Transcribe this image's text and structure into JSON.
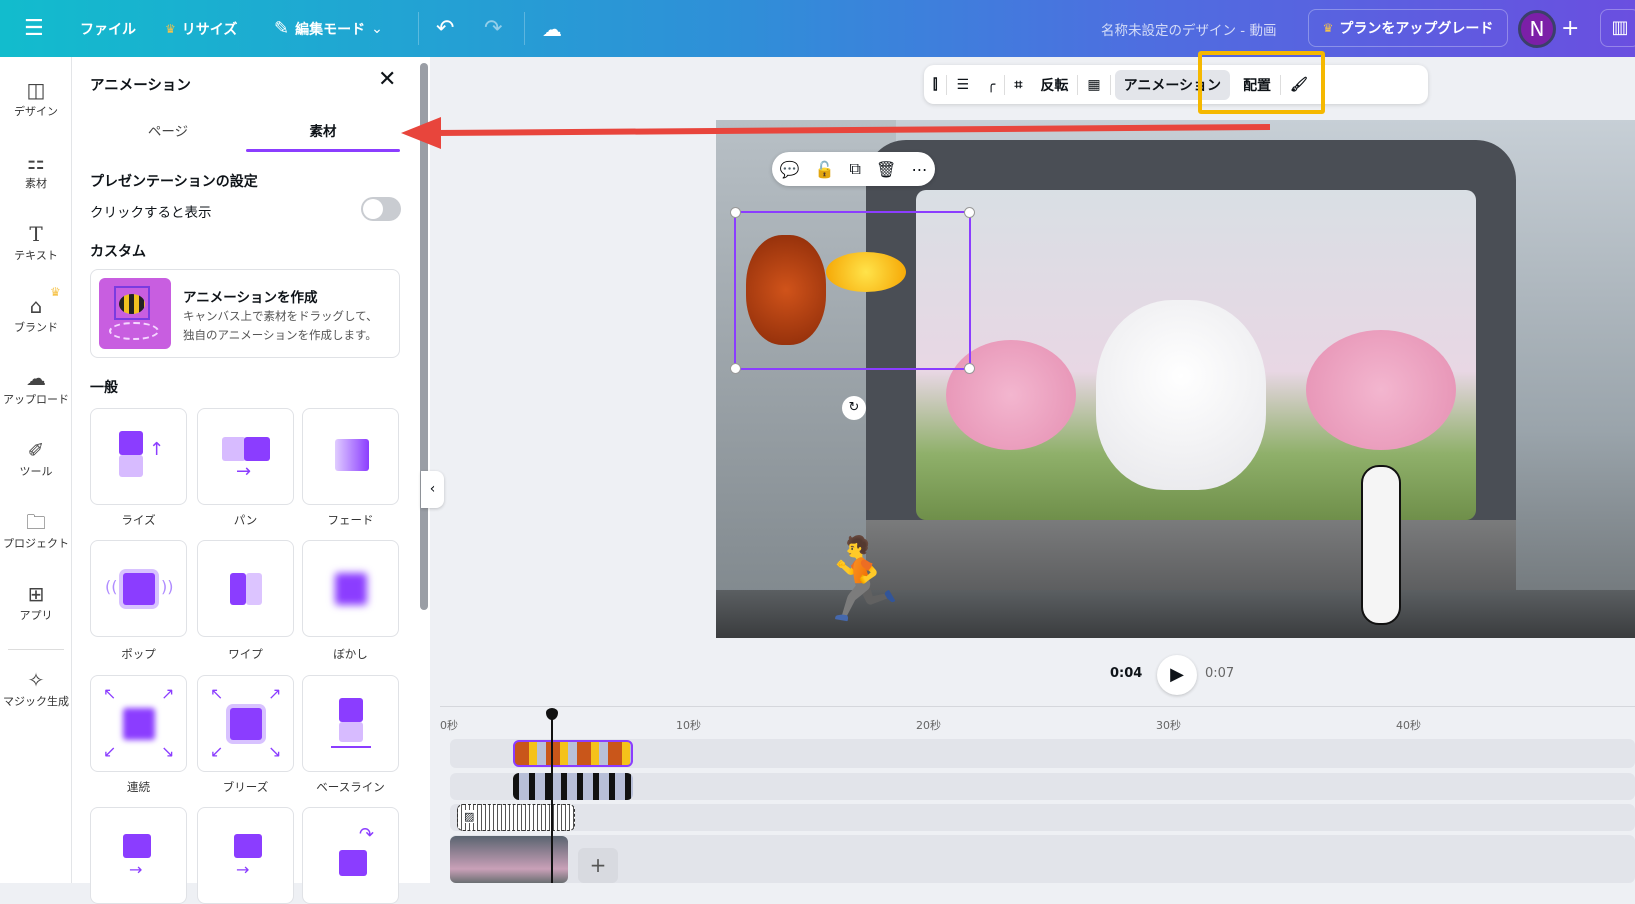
{
  "topbar": {
    "menu_icon": "hamburger-icon",
    "file": "ファイル",
    "resize": "リサイズ",
    "edit_mode": "編集モード",
    "title": "名称未設定のデザイン - 動画",
    "upgrade": "プランをアップグレード",
    "avatar": "N",
    "add": "+"
  },
  "rail": [
    {
      "label": "デザイン",
      "icon": "layout-icon"
    },
    {
      "label": "素材",
      "icon": "shapes-icon"
    },
    {
      "label": "テキスト",
      "icon": "text-icon"
    },
    {
      "label": "ブランド",
      "icon": "brand-icon"
    },
    {
      "label": "アップロード",
      "icon": "upload-icon"
    },
    {
      "label": "ツール",
      "icon": "pen-icon"
    },
    {
      "label": "プロジェクト",
      "icon": "folder-icon"
    },
    {
      "label": "アプリ",
      "icon": "apps-icon"
    },
    {
      "label": "マジック生成",
      "icon": "magic-icon"
    }
  ],
  "panel": {
    "title": "アニメーション",
    "tabs": [
      "ページ",
      "素材"
    ],
    "active_tab": "素材",
    "presentation_heading": "プレゼンテーションの設定",
    "click_to_show": "クリックすると表示",
    "click_to_show_on": false,
    "custom_heading": "カスタム",
    "custom_card": {
      "title": "アニメーションを作成",
      "desc1": "キャンバス上で素材をドラッグして、",
      "desc2": "独自のアニメーションを作成します。"
    },
    "general_heading": "一般",
    "effects": [
      "ライズ",
      "パン",
      "フェード",
      "ポップ",
      "ワイプ",
      "ぼかし",
      "連続",
      "ブリーズ",
      "ベースライン"
    ]
  },
  "toolbar": {
    "flip": "反転",
    "animation": "アニメーション",
    "position": "配置"
  },
  "playback": {
    "current": "0:04",
    "total": "0:07"
  },
  "timeline": {
    "ticks": [
      "0秒",
      "10秒",
      "20秒",
      "30秒",
      "40秒"
    ],
    "playhead_seconds": 4.3
  },
  "colors": {
    "accent": "#8b3dff",
    "highlight": "#f5b800",
    "arrow": "#e8453c"
  }
}
